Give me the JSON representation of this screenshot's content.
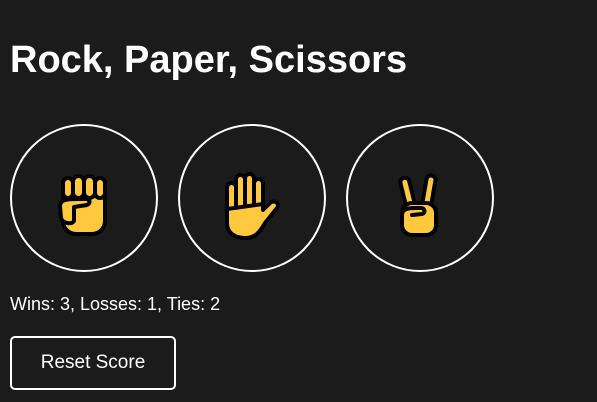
{
  "app": {
    "title": "Rock, Paper, Scissors"
  },
  "choices": [
    {
      "name": "rock",
      "icon": "raised-fist-icon"
    },
    {
      "name": "paper",
      "icon": "raised-hand-icon"
    },
    {
      "name": "scissors",
      "icon": "victory-hand-icon"
    }
  ],
  "score": {
    "text": "Wins: 3, Losses: 1, Ties: 2",
    "wins": 3,
    "losses": 1,
    "ties": 2
  },
  "controls": {
    "reset_label": "Reset Score"
  },
  "colors": {
    "background": "#1b1b1b",
    "foreground": "#ffffff",
    "emoji_skin": "#ffc83d",
    "emoji_outline": "#000000"
  }
}
